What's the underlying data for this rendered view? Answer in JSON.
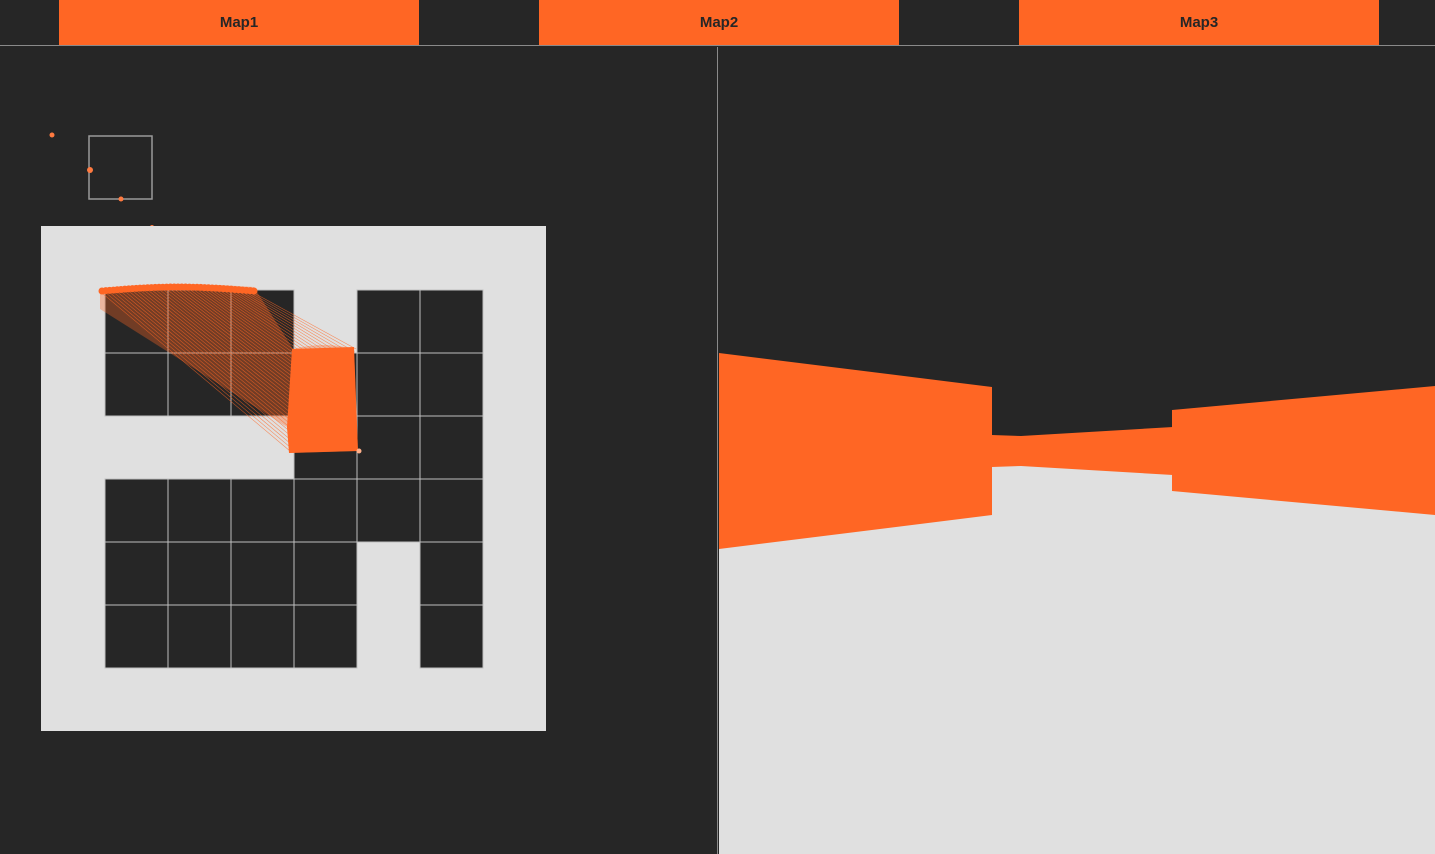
{
  "tabs": [
    {
      "label": "Map1"
    },
    {
      "label": "Map2"
    },
    {
      "label": "Map3"
    }
  ],
  "colors": {
    "background": "#262626",
    "accent": "#ff6624",
    "floor": "#e0e0e0",
    "grid_line": "#bfbfbf",
    "divider": "#8a8a8a"
  },
  "map": {
    "rows": 6,
    "cols": 6,
    "cells": [
      [
        1,
        1,
        1,
        0,
        1,
        1
      ],
      [
        1,
        1,
        1,
        1,
        1,
        1
      ],
      [
        0,
        0,
        0,
        1,
        1,
        1
      ],
      [
        1,
        1,
        1,
        1,
        1,
        1
      ],
      [
        1,
        1,
        1,
        1,
        0,
        1
      ],
      [
        1,
        1,
        1,
        1,
        0,
        1
      ]
    ]
  }
}
